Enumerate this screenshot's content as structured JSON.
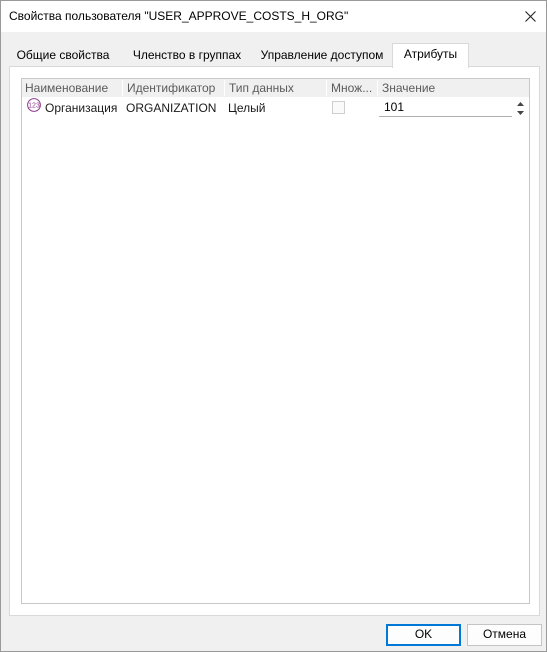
{
  "window": {
    "title": "Свойства пользователя \"USER_APPROVE_COSTS_H_ORG\"",
    "close_icon": "close-icon"
  },
  "tabs": [
    {
      "label": "Общие свойства",
      "active": false
    },
    {
      "label": "Членство в группах",
      "active": false
    },
    {
      "label": "Управление доступом",
      "active": false
    },
    {
      "label": "Атрибуты",
      "active": true
    }
  ],
  "grid": {
    "columns": [
      "Наименование",
      "Идентификатор",
      "Тип данных",
      "Множ...",
      "Значение"
    ],
    "rows": [
      {
        "icon": "integer-type-icon",
        "name": "Организация",
        "identifier": "ORGANIZATION",
        "data_type": "Целый",
        "multiple": false,
        "value": "101"
      }
    ]
  },
  "buttons": {
    "ok": "OK",
    "cancel": "Отмена"
  },
  "colors": {
    "accent": "#0078d7",
    "icon_purple": "#8e3a8e"
  }
}
